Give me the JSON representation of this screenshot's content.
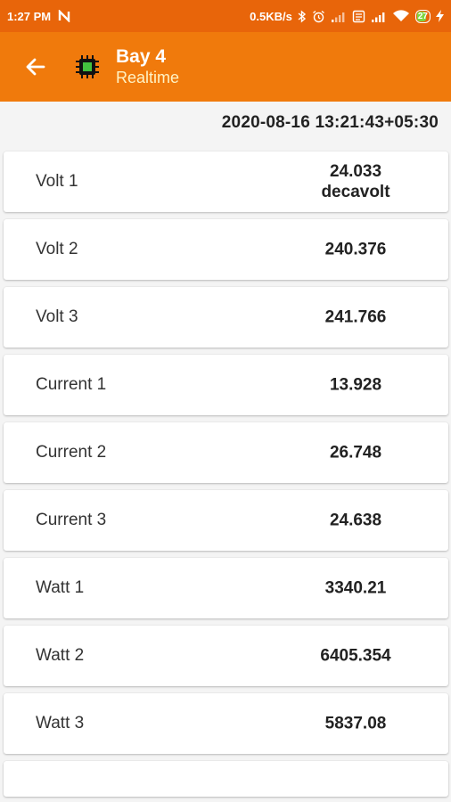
{
  "status_bar": {
    "time": "1:27 PM",
    "notification_icon": "n-icon",
    "network_speed": "0.5KB/s",
    "bluetooth_icon": "bluetooth-icon",
    "alarm_icon": "alarm-icon",
    "signal_icon": "signal-icon",
    "sim_icon": "sim-icon",
    "wifi_icon": "wifi-icon",
    "battery_level": "27",
    "charging_icon": "charging-icon"
  },
  "app_bar": {
    "back_icon": "arrow-back-icon",
    "device_icon": "chip-icon",
    "title": "Bay 4",
    "subtitle": "Realtime",
    "color": "#f07a0c",
    "subtitle_color": "#fff3c4"
  },
  "timestamp": "2020-08-16 13:21:43+05:30",
  "readings": [
    {
      "label": "Volt 1",
      "value": "24.033",
      "unit": "decavolt"
    },
    {
      "label": "Volt 2",
      "value": "240.376",
      "unit": ""
    },
    {
      "label": "Volt 3",
      "value": "241.766",
      "unit": ""
    },
    {
      "label": "Current 1",
      "value": "13.928",
      "unit": ""
    },
    {
      "label": "Current 2",
      "value": "26.748",
      "unit": ""
    },
    {
      "label": "Current 3",
      "value": "24.638",
      "unit": ""
    },
    {
      "label": "Watt 1",
      "value": "3340.21",
      "unit": ""
    },
    {
      "label": "Watt 2",
      "value": "6405.354",
      "unit": ""
    },
    {
      "label": "Watt 3",
      "value": "5837.08",
      "unit": ""
    }
  ]
}
